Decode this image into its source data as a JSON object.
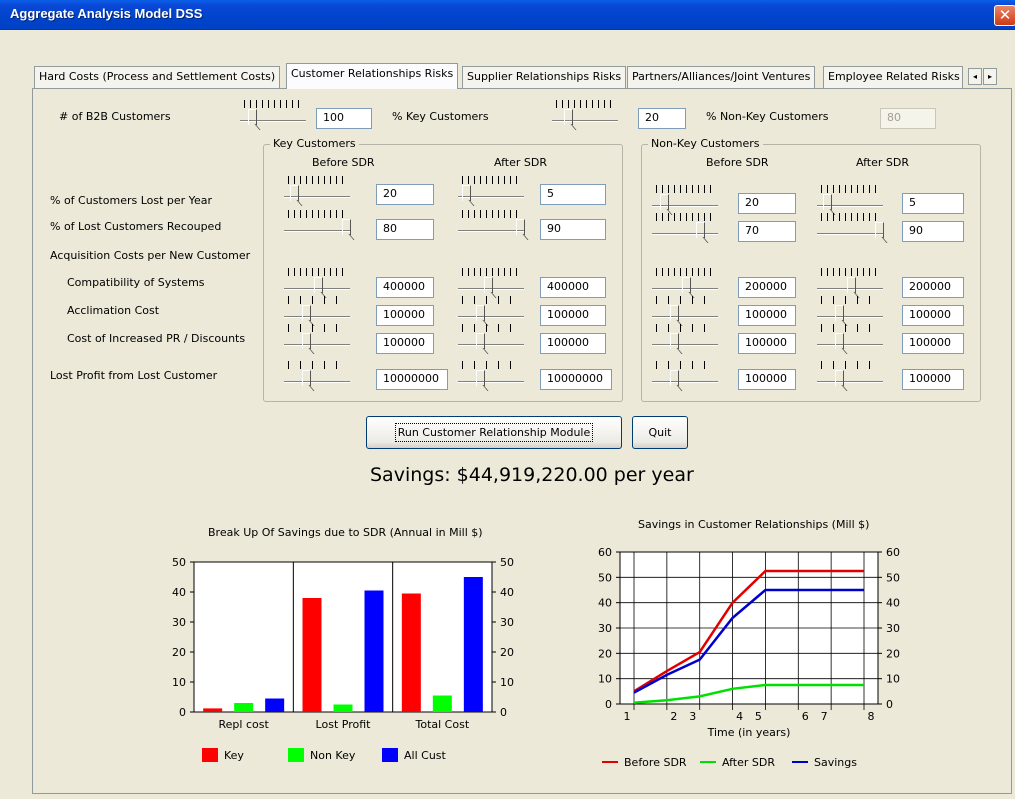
{
  "window": {
    "title": "Aggregate Analysis Model DSS",
    "close_symbol": "✕"
  },
  "tabs": [
    {
      "label": "Hard Costs (Process and Settlement Costs)",
      "active": false
    },
    {
      "label": "Customer Relationships Risks",
      "active": true
    },
    {
      "label": "Supplier Relationships Risks",
      "active": false
    },
    {
      "label": "Partners/Alliances/Joint Ventures",
      "active": false
    },
    {
      "label": "Employee Related Risks",
      "active": false
    }
  ],
  "tab_scroll": {
    "left": "◂",
    "right": "▸"
  },
  "top_row": {
    "b2b_label": "# of B2B Customers",
    "b2b_value": "100",
    "key_pct_label": "% Key Customers",
    "key_pct_value": "20",
    "nonkey_pct_label": "% Non-Key Customers",
    "nonkey_pct_value": "80"
  },
  "row_labels": {
    "lost_per_year": "% of Customers Lost per Year",
    "recouped": "% of Lost Customers Recouped",
    "acq_costs": "Acquisition Costs per New Customer",
    "compat": "Compatibility of Systems",
    "acclim": "Acclimation Cost",
    "pr": "Cost of Increased PR / Discounts",
    "lost_profit": "Lost Profit from Lost Customer"
  },
  "key_group": {
    "title": "Key Customers",
    "before": "Before SDR",
    "after": "After SDR",
    "before_values": [
      "20",
      "80",
      "400000",
      "100000",
      "100000",
      "10000000"
    ],
    "after_values": [
      "5",
      "90",
      "400000",
      "100000",
      "100000",
      "10000000"
    ]
  },
  "nonkey_group": {
    "title": "Non-Key Customers",
    "before": "Before SDR",
    "after": "After SDR",
    "before_values": [
      "20",
      "70",
      "200000",
      "100000",
      "100000",
      "100000"
    ],
    "after_values": [
      "5",
      "90",
      "200000",
      "100000",
      "100000",
      "100000"
    ]
  },
  "buttons": {
    "run": "Run Customer Relationship Module",
    "quit": "Quit"
  },
  "savings_text": "Savings:  $44,919,220.00 per year",
  "chart_data": [
    {
      "type": "bar",
      "title": "Break Up Of Savings due to SDR (Annual in Mill $)",
      "categories": [
        "Repl cost",
        "Lost Profit",
        "Total Cost"
      ],
      "series": [
        {
          "name": "Key",
          "color": "#ff0000",
          "values": [
            1.2,
            38,
            39.5
          ]
        },
        {
          "name": "Non Key",
          "color": "#00ff00",
          "values": [
            3,
            2.5,
            5.5
          ]
        },
        {
          "name": "All Cust",
          "color": "#0000ff",
          "values": [
            4.5,
            40.5,
            45
          ]
        }
      ],
      "ylim": [
        0,
        50
      ],
      "yticks": [
        "0",
        "10",
        "20",
        "30",
        "40",
        "50"
      ],
      "legend_placement": "bottom"
    },
    {
      "type": "line",
      "title": "Savings in Customer Relationships (Mill $)",
      "xlabel": "Time (in years)",
      "x": [
        1,
        2,
        3,
        4,
        5,
        6,
        7,
        8
      ],
      "xticks": [
        "1",
        "2",
        "3",
        "4",
        "5",
        "6",
        "7",
        "8"
      ],
      "series": [
        {
          "name": "Before SDR",
          "color": "#e00000",
          "values": [
            5,
            13,
            20.5,
            40,
            52.5,
            52.5,
            52.5,
            52.5
          ]
        },
        {
          "name": "After SDR",
          "color": "#00e000",
          "values": [
            0.5,
            1.5,
            3,
            6,
            7.5,
            7.5,
            7.5,
            7.5
          ]
        },
        {
          "name": "Savings",
          "color": "#0000cc",
          "values": [
            4.5,
            11.5,
            17.5,
            34,
            45,
            45,
            45,
            45
          ]
        }
      ],
      "ylim": [
        0,
        60
      ],
      "yticks": [
        "0",
        "10",
        "20",
        "30",
        "40",
        "50",
        "60"
      ],
      "grid": true,
      "legend_placement": "bottom"
    }
  ]
}
